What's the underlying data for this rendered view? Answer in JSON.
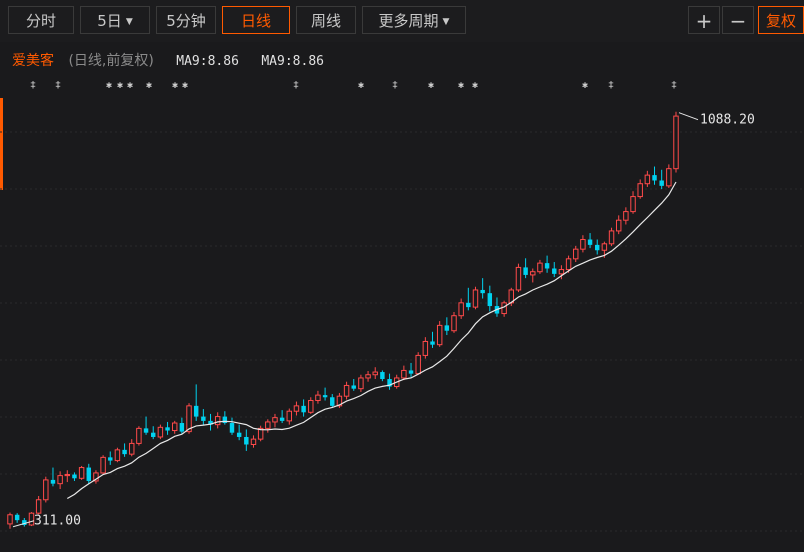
{
  "toolbar": {
    "fenshi": "分时",
    "day5": "5日",
    "min5": "5分钟",
    "daily": "日线",
    "weekly": "周线",
    "more": "更多周期",
    "plus": "+",
    "minus": "−",
    "restore": "复权"
  },
  "legend": {
    "stock": "爱美客",
    "period": "(日线,前复权)",
    "ma_a": "MA9:8.86",
    "ma_b": "MA9:8.86"
  },
  "markers": [
    "‡",
    "‡",
    "✱",
    "✱",
    "✱",
    "✱",
    "✱",
    "✱",
    "‡",
    "✱",
    "‡",
    "✱",
    "✱",
    "✱",
    "✱",
    "‡"
  ],
  "colors": {
    "up": "#ff4a4a",
    "down": "#00d2f0",
    "ma": "#e8e8e8",
    "accent": "#ff5a00"
  },
  "chart_data": {
    "type": "candlestick",
    "ylim": [
      290,
      1110
    ],
    "annotations": {
      "max_label": "1088.20",
      "min_label": "311.00"
    },
    "ohlc": [
      [
        320,
        341,
        311,
        337
      ],
      [
        337,
        340,
        322,
        327
      ],
      [
        327,
        331,
        315,
        318
      ],
      [
        318,
        342,
        316,
        340
      ],
      [
        340,
        372,
        338,
        365
      ],
      [
        365,
        408,
        360,
        402
      ],
      [
        402,
        425,
        390,
        395
      ],
      [
        395,
        418,
        385,
        410
      ],
      [
        410,
        420,
        398,
        412
      ],
      [
        412,
        416,
        400,
        405
      ],
      [
        405,
        428,
        402,
        425
      ],
      [
        425,
        432,
        395,
        400
      ],
      [
        400,
        420,
        395,
        415
      ],
      [
        415,
        448,
        412,
        444
      ],
      [
        444,
        455,
        430,
        438
      ],
      [
        438,
        462,
        435,
        458
      ],
      [
        458,
        470,
        445,
        450
      ],
      [
        450,
        478,
        446,
        470
      ],
      [
        470,
        502,
        466,
        498
      ],
      [
        498,
        520,
        486,
        490
      ],
      [
        490,
        502,
        478,
        482
      ],
      [
        482,
        505,
        478,
        500
      ],
      [
        500,
        510,
        486,
        494
      ],
      [
        494,
        512,
        488,
        508
      ],
      [
        508,
        518,
        488,
        492
      ],
      [
        492,
        545,
        488,
        540
      ],
      [
        540,
        580,
        512,
        520
      ],
      [
        520,
        534,
        505,
        512
      ],
      [
        512,
        525,
        494,
        505
      ],
      [
        505,
        528,
        498,
        520
      ],
      [
        520,
        530,
        505,
        508
      ],
      [
        508,
        518,
        486,
        490
      ],
      [
        490,
        505,
        476,
        482
      ],
      [
        482,
        496,
        456,
        468
      ],
      [
        468,
        485,
        462,
        478
      ],
      [
        478,
        503,
        474,
        498
      ],
      [
        498,
        515,
        490,
        510
      ],
      [
        510,
        525,
        500,
        518
      ],
      [
        518,
        532,
        508,
        512
      ],
      [
        512,
        535,
        505,
        530
      ],
      [
        530,
        548,
        522,
        540
      ],
      [
        540,
        552,
        520,
        528
      ],
      [
        528,
        556,
        525,
        550
      ],
      [
        550,
        568,
        544,
        560
      ],
      [
        560,
        574,
        550,
        556
      ],
      [
        556,
        562,
        536,
        540
      ],
      [
        540,
        564,
        536,
        558
      ],
      [
        558,
        585,
        552,
        578
      ],
      [
        578,
        590,
        568,
        572
      ],
      [
        572,
        598,
        566,
        592
      ],
      [
        592,
        605,
        585,
        598
      ],
      [
        598,
        612,
        590,
        603
      ],
      [
        603,
        606,
        586,
        590
      ],
      [
        590,
        600,
        570,
        576
      ],
      [
        576,
        598,
        572,
        592
      ],
      [
        592,
        615,
        588,
        606
      ],
      [
        606,
        620,
        594,
        600
      ],
      [
        600,
        640,
        598,
        634
      ],
      [
        634,
        668,
        628,
        660
      ],
      [
        660,
        678,
        648,
        654
      ],
      [
        654,
        698,
        650,
        690
      ],
      [
        690,
        705,
        672,
        680
      ],
      [
        680,
        715,
        676,
        708
      ],
      [
        708,
        740,
        702,
        732
      ],
      [
        732,
        760,
        718,
        724
      ],
      [
        724,
        762,
        720,
        756
      ],
      [
        756,
        778,
        740,
        750
      ],
      [
        750,
        764,
        716,
        726
      ],
      [
        726,
        742,
        706,
        712
      ],
      [
        712,
        736,
        706,
        732
      ],
      [
        732,
        760,
        726,
        756
      ],
      [
        756,
        805,
        752,
        798
      ],
      [
        798,
        815,
        778,
        784
      ],
      [
        784,
        796,
        770,
        790
      ],
      [
        790,
        812,
        786,
        806
      ],
      [
        806,
        820,
        788,
        796
      ],
      [
        796,
        808,
        780,
        786
      ],
      [
        786,
        802,
        776,
        794
      ],
      [
        794,
        820,
        788,
        814
      ],
      [
        814,
        838,
        808,
        832
      ],
      [
        832,
        858,
        826,
        850
      ],
      [
        850,
        862,
        834,
        840
      ],
      [
        840,
        850,
        822,
        830
      ],
      [
        830,
        846,
        816,
        842
      ],
      [
        842,
        872,
        838,
        866
      ],
      [
        866,
        895,
        860,
        886
      ],
      [
        886,
        910,
        878,
        902
      ],
      [
        902,
        940,
        898,
        930
      ],
      [
        930,
        962,
        926,
        954
      ],
      [
        954,
        978,
        948,
        970
      ],
      [
        970,
        986,
        952,
        960
      ],
      [
        960,
        980,
        944,
        950
      ],
      [
        950,
        990,
        946,
        982
      ],
      [
        982,
        1088.2,
        975,
        1080
      ]
    ]
  }
}
